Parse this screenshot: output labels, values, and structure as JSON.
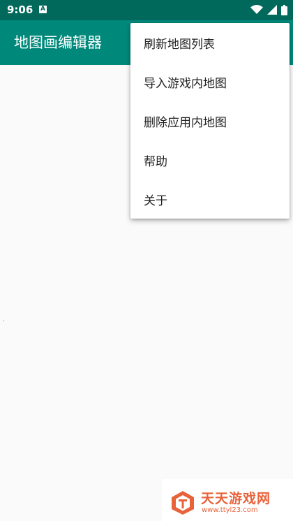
{
  "status_bar": {
    "time": "9:06",
    "notification_icon": "a-letter-icon",
    "icons": [
      "wifi-icon",
      "signal-icon",
      "battery-icon"
    ]
  },
  "app_bar": {
    "title": "地图画编辑器"
  },
  "menu": {
    "items": [
      {
        "label": "刷新地图列表"
      },
      {
        "label": "导入游戏内地图"
      },
      {
        "label": "删除应用内地图"
      },
      {
        "label": "帮助"
      },
      {
        "label": "关于"
      }
    ]
  },
  "watermark": {
    "name": "天天游戏网",
    "url": "www.ttyl23.com"
  },
  "colors": {
    "status_bar": "#00695c",
    "app_bar": "#00897b",
    "background": "#fafafa",
    "menu_background": "#ffffff",
    "watermark_accent": "#e8623a"
  }
}
